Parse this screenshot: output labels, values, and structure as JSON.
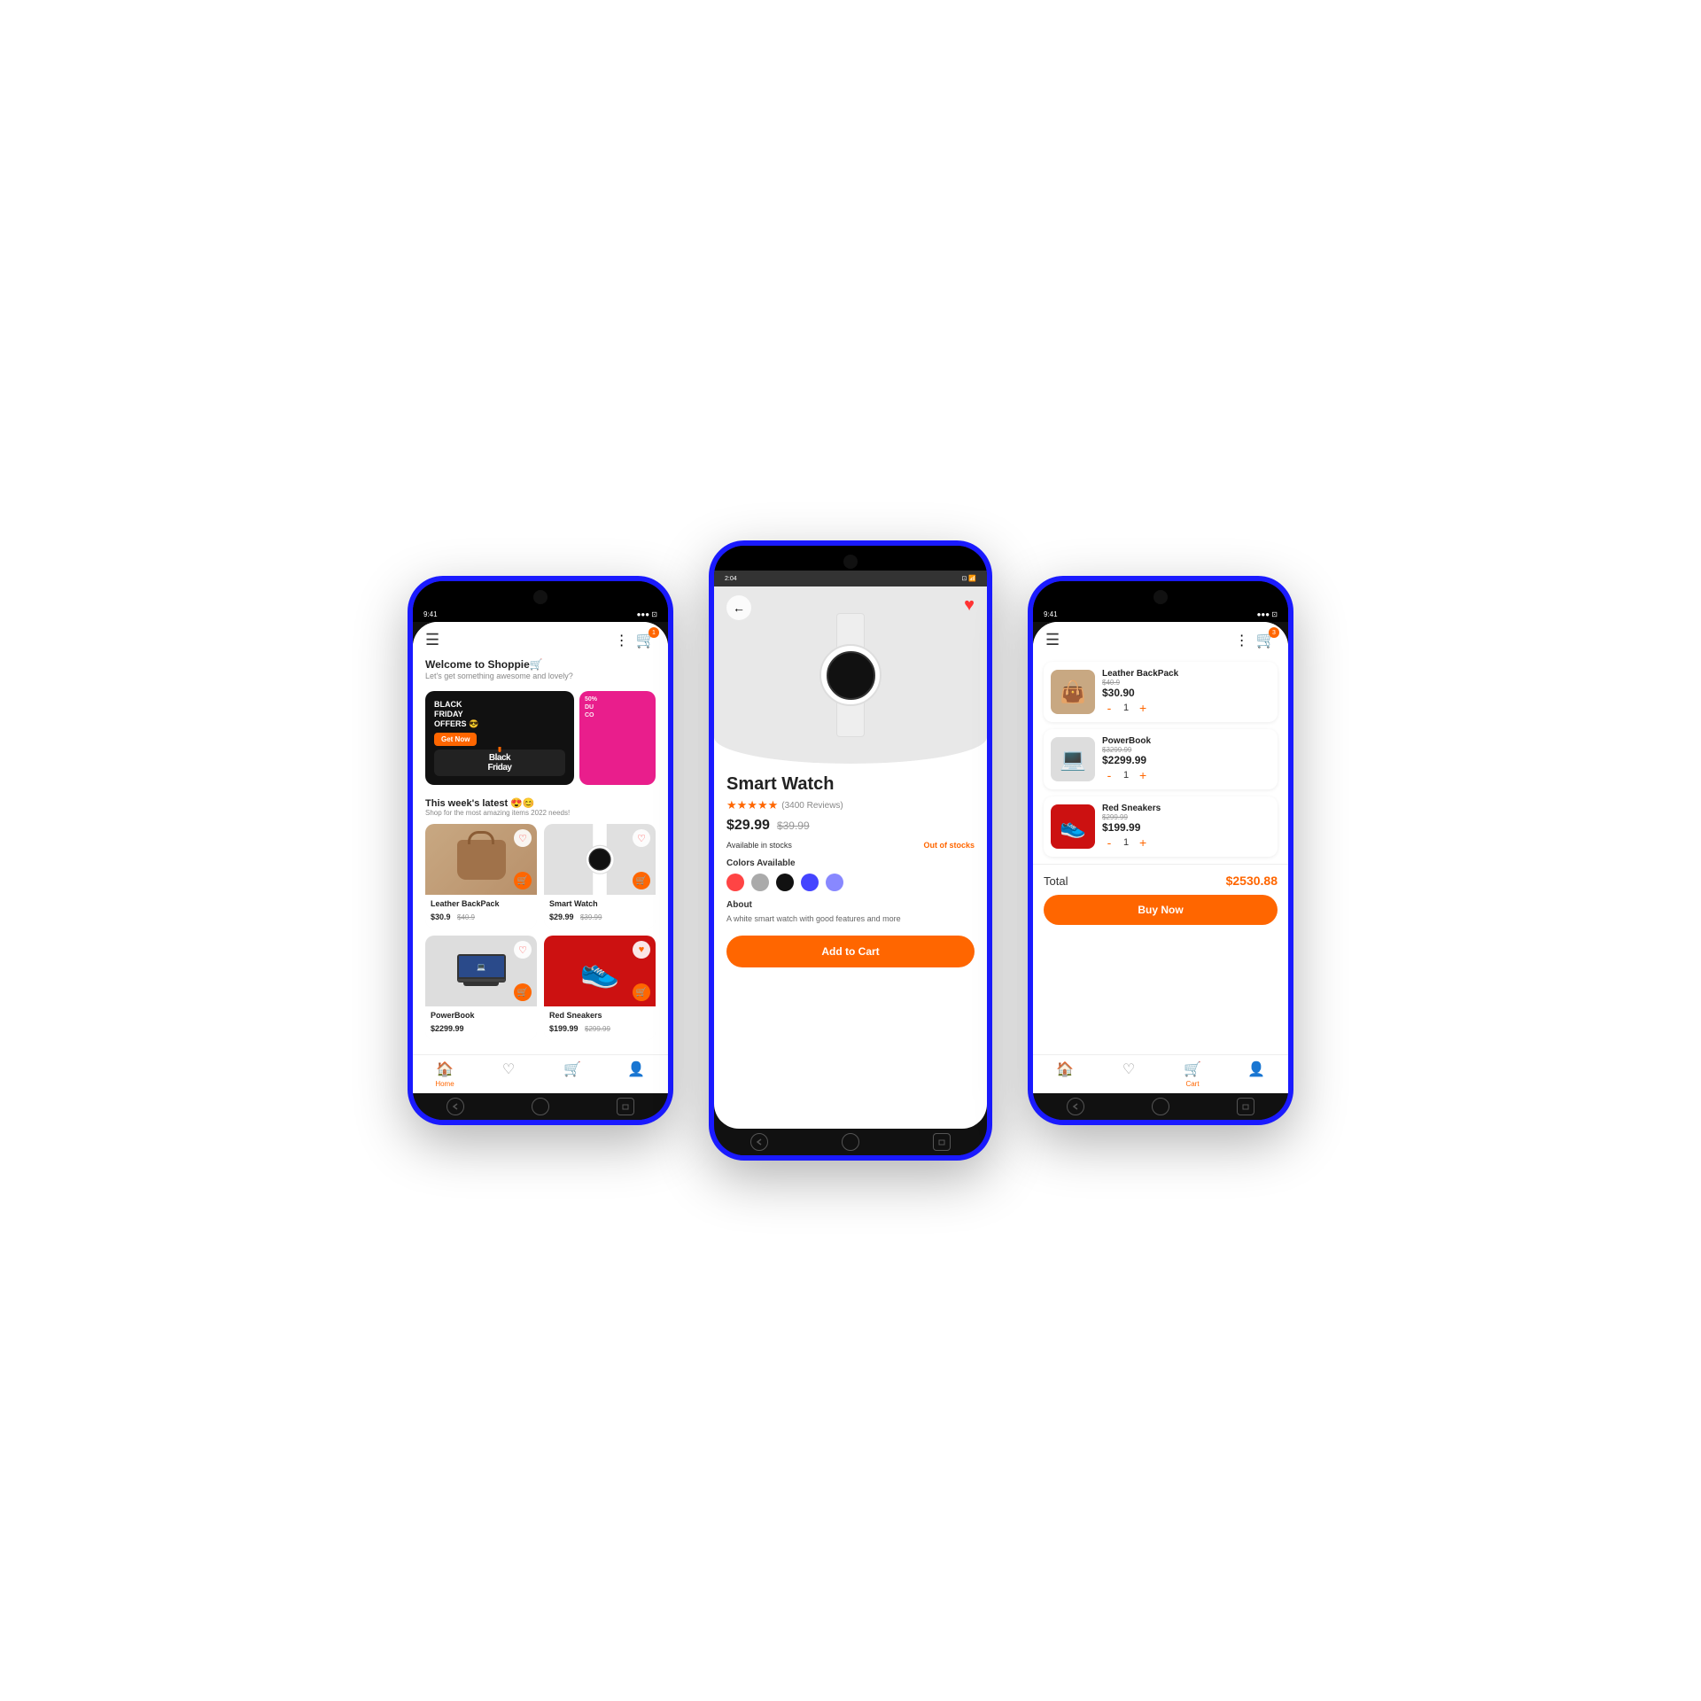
{
  "phone1": {
    "status": {
      "time": "9:41",
      "battery": "100%",
      "signal": "●●●"
    },
    "welcome": {
      "title": "Welcome to Shoppie🛒",
      "subtitle": "Let's get something awesome and lovely?"
    },
    "banner": {
      "main": {
        "title": "BLACK FRIDAY OFFERS 😎",
        "tag": "Black Friday",
        "button": "Get Now"
      },
      "side": {
        "lines": [
          "50% DU",
          "CO"
        ]
      }
    },
    "section_title": "This week's latest 😍😊",
    "section_subtitle": "Shop for the most amazing items 2022 needs!",
    "products": [
      {
        "name": "Leather BackPack",
        "price": "$30.9",
        "old_price": "$40.9",
        "type": "bag"
      },
      {
        "name": "Smart Watch",
        "price": "$29.99",
        "old_price": "$39.99",
        "type": "watch"
      },
      {
        "name": "PowerBook",
        "price": "$2299.99",
        "old_price": "",
        "type": "laptop"
      },
      {
        "name": "Red Sneakers",
        "price": "$199.99",
        "old_price": "$299.99",
        "type": "sneaker"
      }
    ],
    "nav": [
      {
        "label": "Home",
        "icon": "🏠",
        "active": true
      },
      {
        "label": "Wishlist",
        "icon": "♡",
        "active": false
      },
      {
        "label": "Cart",
        "icon": "🛒",
        "active": false
      },
      {
        "label": "Profile",
        "icon": "👤",
        "active": false
      }
    ]
  },
  "phone2": {
    "status": {
      "time": "2:04",
      "battery": "85%",
      "signal": "●●●"
    },
    "product": {
      "name": "Smart Watch",
      "stars": 4.5,
      "reviews": "(3400 Reviews)",
      "price": "$29.99",
      "old_price": "$39.99",
      "in_stock_label": "Available in stocks",
      "out_stock_label": "Out of stocks",
      "colors_label": "Colors Available",
      "colors": [
        "#f44",
        "#aaa",
        "#111",
        "#44f",
        "#88f"
      ],
      "about_label": "About",
      "about_text": "A white smart watch with good features and more",
      "add_to_cart": "Add to Cart"
    }
  },
  "phone3": {
    "status": {
      "time": "9:41",
      "battery": "100%",
      "signal": "●●●"
    },
    "cart_items": [
      {
        "name": "Leather BackPack",
        "price": "$30.90",
        "old_price": "$40.9",
        "qty": 1,
        "type": "bag"
      },
      {
        "name": "PowerBook",
        "price": "$2299.99",
        "old_price": "$3299.99",
        "qty": 1,
        "type": "laptop"
      },
      {
        "name": "Red Sneakers",
        "price": "$199.99",
        "old_price": "$299.99",
        "qty": 1,
        "type": "sneaker"
      }
    ],
    "total_label": "Total",
    "total_amount": "$2530.88",
    "buy_now": "Buy Now",
    "nav": [
      {
        "label": "Home",
        "icon": "🏠",
        "active": false
      },
      {
        "label": "Wishlist",
        "icon": "♡",
        "active": false
      },
      {
        "label": "Cart",
        "icon": "🛒",
        "active": true
      },
      {
        "label": "Profile",
        "icon": "👤",
        "active": false
      }
    ]
  }
}
